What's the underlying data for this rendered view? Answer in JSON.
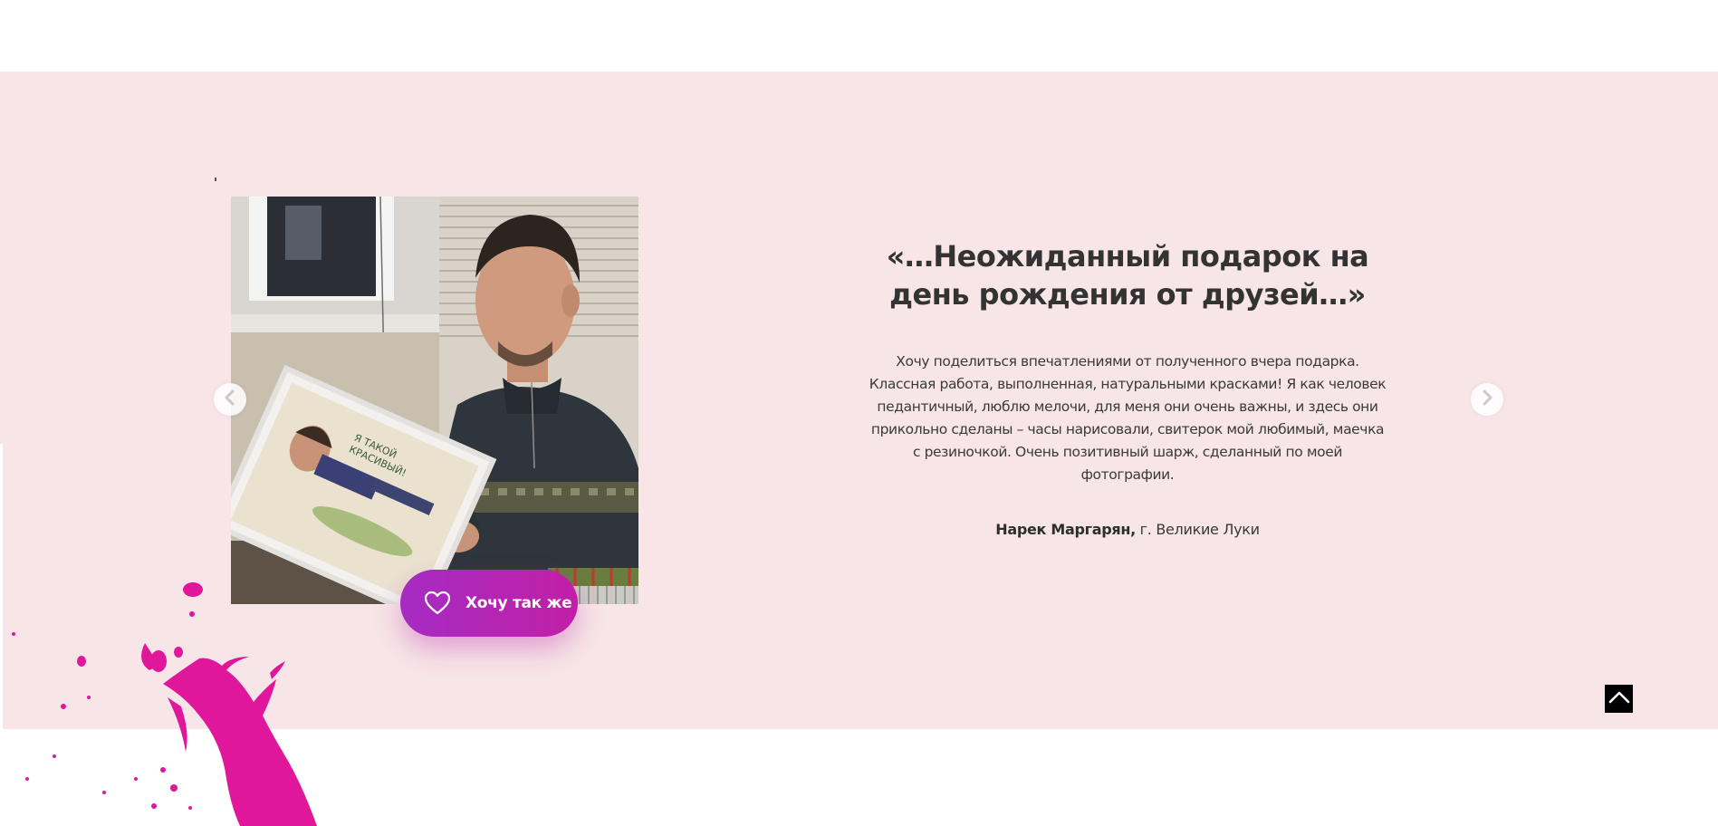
{
  "testimonial": {
    "title": "«…Неожиданный подарок на день рождения от друзей…»",
    "body": "Хочу поделиться впечатлениями от полученного вчера подарка. Классная работа, выполненная, натуральными красками! Я как человек педантичный, люблю мелочи, для меня они очень важны, и здесь они прикольно сделаны – часы нарисовали, свитерок мой любимый, маечка с резиночкой. Очень позитивный шарж, сделанный по моей фотографии.",
    "author_name": "Нарек Маргарян,",
    "author_city": " г. Великие Луки",
    "photo_caption_on_picture": "Я ТАКОЙ КРАСИВЫЙ"
  },
  "cta": {
    "label": "Хочу так же",
    "icon": "heart-outline-icon"
  },
  "carousel": {
    "prev_icon": "chevron-left-icon",
    "next_icon": "chevron-right-icon"
  },
  "scroll_top": {
    "icon": "chevron-up-icon"
  },
  "colors": {
    "section_background": "#f7e5e7",
    "accent_gradient_start": "#a52cc2",
    "accent_gradient_end": "#c21fa6",
    "splash": "#e0179b",
    "text": "#333333"
  }
}
